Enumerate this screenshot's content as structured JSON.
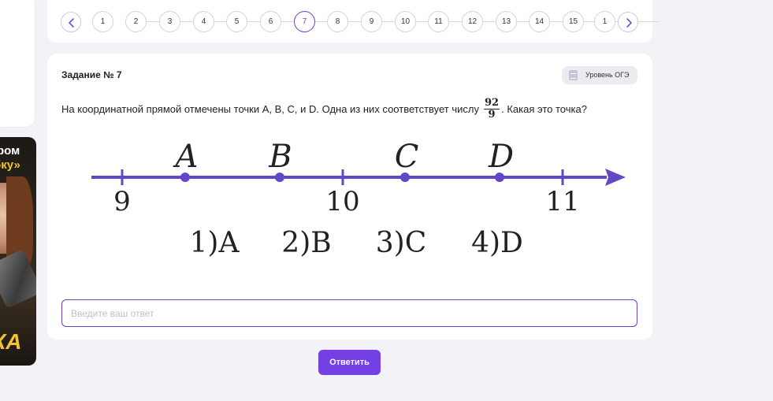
{
  "promo": {
    "line1": "ром",
    "line2": "бку»",
    "line3": "КА"
  },
  "pager": {
    "pages": [
      "1",
      "2",
      "3",
      "4",
      "5",
      "6",
      "7",
      "8",
      "9",
      "10",
      "11",
      "12",
      "13",
      "14",
      "15",
      "1"
    ],
    "active_page": "7"
  },
  "task": {
    "title": "Задание № 7",
    "level": "Уровень ОГЭ",
    "question_before": "На координатной прямой отмечены точки A, B, C, и D. Одна из них соответствует числу",
    "fraction_num": "92",
    "fraction_den": "9",
    "question_after": ". Какая это точка?"
  },
  "figure": {
    "ticks": [
      "9",
      "10",
      "11"
    ],
    "points": [
      "A",
      "B",
      "C",
      "D"
    ],
    "options": [
      "1)A",
      "2)B",
      "3)C",
      "4)D"
    ],
    "accent_color": "#6247c7"
  },
  "answer": {
    "placeholder": "Введите ваш ответ",
    "value": ""
  },
  "submit_label": "Ответить",
  "colors": {
    "accent": "#7440e3",
    "page_bg": "#f3f2f7"
  }
}
